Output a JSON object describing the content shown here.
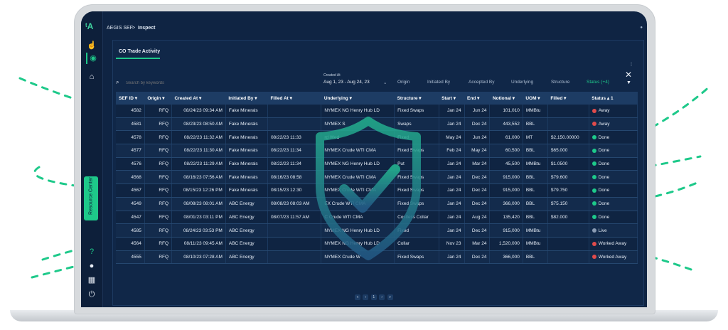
{
  "app": {
    "breadcrumb_app": "AEGIS SEF",
    "breadcrumb_sep": ">",
    "breadcrumb_page": "Inspect"
  },
  "sidebar": {
    "logo": "ᵗA",
    "resource_center": "Resource Center"
  },
  "tab_label": "CO Trade Activity",
  "search": {
    "placeholder": "Search by keywords"
  },
  "filters": {
    "created_label": "Created At",
    "created_value": "Aug 1, 23 - Aug 24, 23",
    "origin": "Origin",
    "initiated_by": "Initiated By",
    "accepted_by": "Accepted By",
    "underlying": "Underlying",
    "structure": "Structure",
    "status": "Status (+4)"
  },
  "columns": [
    "SEF ID ▾",
    "Origin ▾",
    "Created At ▾",
    "Initiated By ▾",
    "Filled At ▾",
    "Underlying ▾",
    "Structure ▾",
    "Start ▾",
    "End ▾",
    "Notional ▾",
    "UOM ▾",
    "Filled ▾",
    "Status ▴ 1"
  ],
  "rows": [
    {
      "id": "4582",
      "origin": "RFQ",
      "created": "08/24/23 09:34 AM",
      "init": "Fake Minerals",
      "filled_at": "",
      "under": "NYMEX NG Henry Hub LD",
      "struct": "Fixed Swaps",
      "start": "Jan 24",
      "end": "Jun 24",
      "notional": "101,010",
      "uom": "MMBtu",
      "filled": "",
      "status": "Away",
      "sc": "#e04b4b"
    },
    {
      "id": "4581",
      "origin": "RFQ",
      "created": "08/23/23 08:50 AM",
      "init": "Fake Minerals",
      "filled_at": "",
      "under": "NYMEX S",
      "struct": "Swaps",
      "start": "Jan 24",
      "end": "Dec 24",
      "notional": "443,552",
      "uom": "BBL",
      "filled": "",
      "status": "Away",
      "sc": "#e04b4b"
    },
    {
      "id": "4578",
      "origin": "RFQ",
      "created": "08/22/23 11:32 AM",
      "init": "Fake Minerals",
      "filled_at": "08/22/23 11:33",
      "under": "rd Wed",
      "struct": "Fixed",
      "start": "May 24",
      "end": "Jun 24",
      "notional": "61,000",
      "uom": "MT",
      "filled": "$2,150.00000",
      "status": "Done",
      "sc": "#1ec98a"
    },
    {
      "id": "4577",
      "origin": "RFQ",
      "created": "08/22/23 11:30 AM",
      "init": "Fake Minerals",
      "filled_at": "08/22/23 11:34",
      "under": "NYMEX Crude WTI CMA",
      "struct": "Fixed Swaps",
      "start": "Feb 24",
      "end": "May 24",
      "notional": "60,500",
      "uom": "BBL",
      "filled": "$65.000",
      "status": "Done",
      "sc": "#1ec98a"
    },
    {
      "id": "4576",
      "origin": "RFQ",
      "created": "08/22/23 11:29 AM",
      "init": "Fake Minerals",
      "filled_at": "08/22/23 11:34",
      "under": "NYMEX NG Henry Hub LD",
      "struct": "Put",
      "start": "Jan 24",
      "end": "Mar 24",
      "notional": "45,500",
      "uom": "MMBtu",
      "filled": "$1.0500",
      "status": "Done",
      "sc": "#1ec98a"
    },
    {
      "id": "4568",
      "origin": "RFQ",
      "created": "08/16/23 07:56 AM",
      "init": "Fake Minerals",
      "filled_at": "08/16/23 08:58",
      "under": "NYMEX Crude WTI CMA",
      "struct": "Fixed Swaps",
      "start": "Jan 24",
      "end": "Dec 24",
      "notional": "915,000",
      "uom": "BBL",
      "filled": "$79.600",
      "status": "Done",
      "sc": "#1ec98a"
    },
    {
      "id": "4567",
      "origin": "RFQ",
      "created": "08/15/23 12:26 PM",
      "init": "Fake Minerals",
      "filled_at": "08/15/23 12:30",
      "under": "NYMEX Crude WTI CMA",
      "struct": "Fixed Swaps",
      "start": "Jan 24",
      "end": "Dec 24",
      "notional": "915,000",
      "uom": "BBL",
      "filled": "$79.750",
      "status": "Done",
      "sc": "#1ec98a"
    },
    {
      "id": "4549",
      "origin": "RFQ",
      "created": "08/08/23 08:01 AM",
      "init": "ABC Energy",
      "filled_at": "08/08/23 08:03 AM",
      "under": "EX Crude WTI CMA",
      "struct": "Fixed Swaps",
      "start": "Jan 24",
      "end": "Dec 24",
      "notional": "366,000",
      "uom": "BBL",
      "filled": "$75.150",
      "status": "Done",
      "sc": "#1ec98a"
    },
    {
      "id": "4547",
      "origin": "RFQ",
      "created": "08/01/23 03:11 PM",
      "init": "ABC Energy",
      "filled_at": "08/07/23 11:57 AM",
      "under": "C Crude WTI CMA",
      "struct": "Costless Collar",
      "start": "Jan 24",
      "end": "Aug 24",
      "notional": "135,420",
      "uom": "BBL",
      "filled": "$82.000",
      "status": "Done",
      "sc": "#1ec98a"
    },
    {
      "id": "4585",
      "origin": "RFQ",
      "created": "08/24/23 03:53 PM",
      "init": "ABC Energy",
      "filled_at": "",
      "under": "NYMEX NG Henry Hub LD",
      "struct": "Fixed",
      "start": "Jan 24",
      "end": "Dec 24",
      "notional": "915,000",
      "uom": "MMBtu",
      "filled": "",
      "status": "Live",
      "sc": "#8a9bb3"
    },
    {
      "id": "4564",
      "origin": "RFQ",
      "created": "08/11/23 09:45 AM",
      "init": "ABC Energy",
      "filled_at": "",
      "under": "NYMEX NG Henry Hub LD",
      "struct": "Collar",
      "start": "Nov 23",
      "end": "Mar 24",
      "notional": "1,520,000",
      "uom": "MMBtu",
      "filled": "",
      "status": "Worked Away",
      "sc": "#e04b4b"
    },
    {
      "id": "4555",
      "origin": "RFQ",
      "created": "08/10/23 07:28 AM",
      "init": "ABC Energy",
      "filled_at": "",
      "under": "NYMEX Crude W",
      "struct": "Fixed Swaps",
      "start": "Jan 24",
      "end": "Dec 24",
      "notional": "366,000",
      "uom": "BBL",
      "filled": "",
      "status": "Worked Away",
      "sc": "#e04b4b"
    }
  ],
  "pager": {
    "first": "«",
    "prev": "‹",
    "page": "1",
    "next": "›",
    "last": "»"
  },
  "colors": {
    "accent": "#1ec98a",
    "navy": "#0f2443",
    "shield": "#1a9f86"
  }
}
